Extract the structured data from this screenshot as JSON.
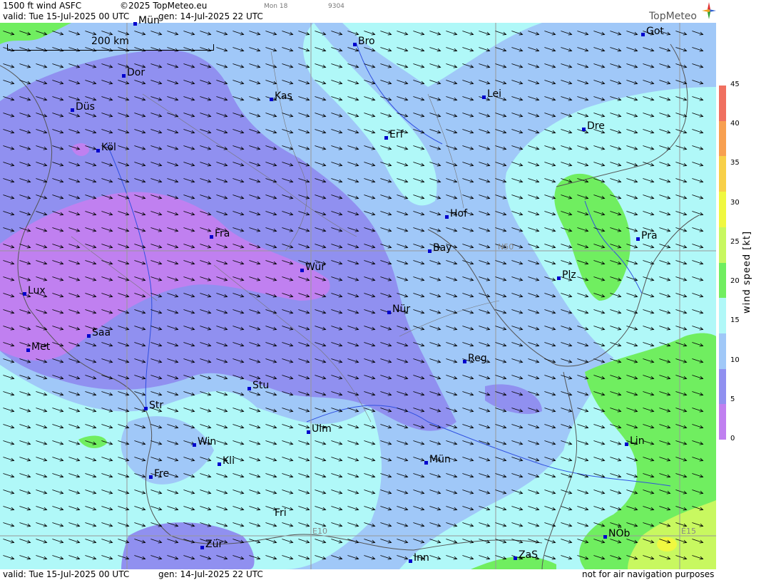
{
  "header": {
    "title": "1500 ft wind ASFC",
    "copyright": "©2025 TopMeteo.eu",
    "extra1": "Mon 18",
    "extra2": "9304",
    "valid": "valid:  Tue  15-Jul-2025  00 UTC",
    "gen": "gen: 14-Jul-2025 22 UTC",
    "logo": "TopMeteo"
  },
  "footer": {
    "valid": "valid:  Tue  15-Jul-2025  00 UTC",
    "gen": "gen: 14-Jul-2025 22 UTC",
    "disclaimer": "not for air navigation purposes"
  },
  "scale": {
    "label": "200 km"
  },
  "grid_labels": {
    "n50": "N50",
    "e10": "E10",
    "e15": "E15"
  },
  "legend": {
    "title": "wind speed [kt]",
    "ticks": [
      "45",
      "40",
      "35",
      "30",
      "25",
      "20",
      "15",
      "10",
      "5",
      "0"
    ],
    "colors": [
      "#f07060",
      "#f8a050",
      "#f8d048",
      "#f0f840",
      "#c8f860",
      "#70ee60",
      "#b0f8f8",
      "#a0c8f8",
      "#9090f0",
      "#c080f0"
    ]
  },
  "cities": [
    {
      "name": "Mün",
      "id": "mun-north"
    },
    {
      "name": "Bro"
    },
    {
      "name": "Got"
    },
    {
      "name": "Dor"
    },
    {
      "name": "Kas"
    },
    {
      "name": "Lei"
    },
    {
      "name": "Düs"
    },
    {
      "name": "Erf"
    },
    {
      "name": "Dre"
    },
    {
      "name": "Köl"
    },
    {
      "name": "Hof"
    },
    {
      "name": "Fra"
    },
    {
      "name": "Pra"
    },
    {
      "name": "Bay"
    },
    {
      "name": "Würz",
      "display": "Wür"
    },
    {
      "name": "Plz"
    },
    {
      "name": "Lux"
    },
    {
      "name": "Nür"
    },
    {
      "name": "Saa"
    },
    {
      "name": "Met"
    },
    {
      "name": "Reg"
    },
    {
      "name": "Stu"
    },
    {
      "name": "Str"
    },
    {
      "name": "Ulm"
    },
    {
      "name": "Lin"
    },
    {
      "name": "Win"
    },
    {
      "name": "Kli"
    },
    {
      "name": "Mün",
      "id": "munich"
    },
    {
      "name": "Fre"
    },
    {
      "name": "Fri"
    },
    {
      "name": "NÖb"
    },
    {
      "name": "Zür"
    },
    {
      "name": "Inn"
    },
    {
      "name": "ZaS"
    }
  ]
}
